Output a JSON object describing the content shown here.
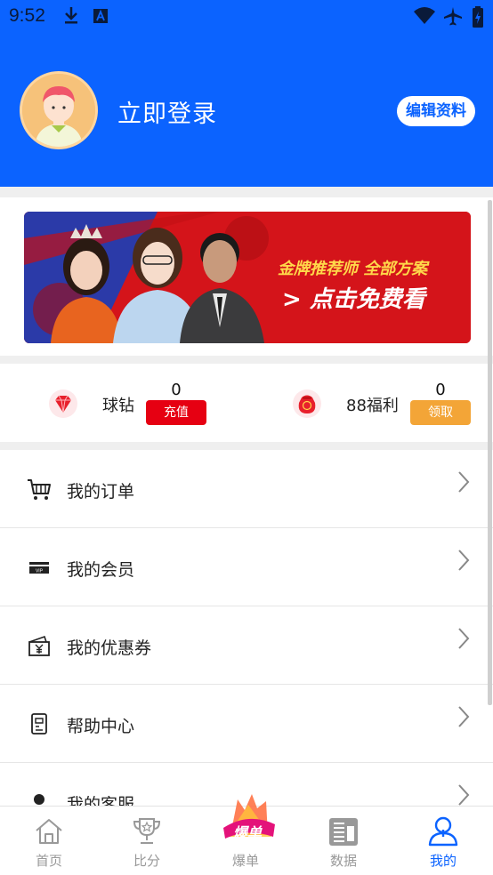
{
  "status_bar": {
    "time": "9:52"
  },
  "profile": {
    "login_text": "立即登录",
    "edit_button": "编辑资料"
  },
  "banner": {
    "headline": "金牌推荐师 全部方案",
    "cta": "> 点击免费看"
  },
  "assets": [
    {
      "label": "球钻",
      "value": "0",
      "button": "充值",
      "button_color": "#e60012",
      "icon": "diamond-icon"
    },
    {
      "label": "88福利",
      "value": "0",
      "button": "领取",
      "button_color": "#f3a537",
      "icon": "red-envelope-icon"
    }
  ],
  "menu": {
    "items": [
      {
        "label": "我的订单",
        "icon": "cart-icon"
      },
      {
        "label": "我的会员",
        "icon": "vip-card-icon"
      },
      {
        "label": "我的优惠券",
        "icon": "coupon-icon"
      },
      {
        "label": "帮助中心",
        "icon": "help-icon"
      },
      {
        "label": "我的客服",
        "icon": "customer-service-icon"
      }
    ]
  },
  "tabbar": {
    "tabs": [
      {
        "label": "首页",
        "icon": "home-icon"
      },
      {
        "label": "比分",
        "icon": "trophy-icon"
      },
      {
        "label": "爆单",
        "icon": "hot-icon",
        "badge": "爆单"
      },
      {
        "label": "数据",
        "icon": "data-icon"
      },
      {
        "label": "我的",
        "icon": "user-icon",
        "active": true
      }
    ]
  },
  "colors": {
    "brand_blue": "#0b63ff",
    "banner_red": "#d4141a"
  }
}
